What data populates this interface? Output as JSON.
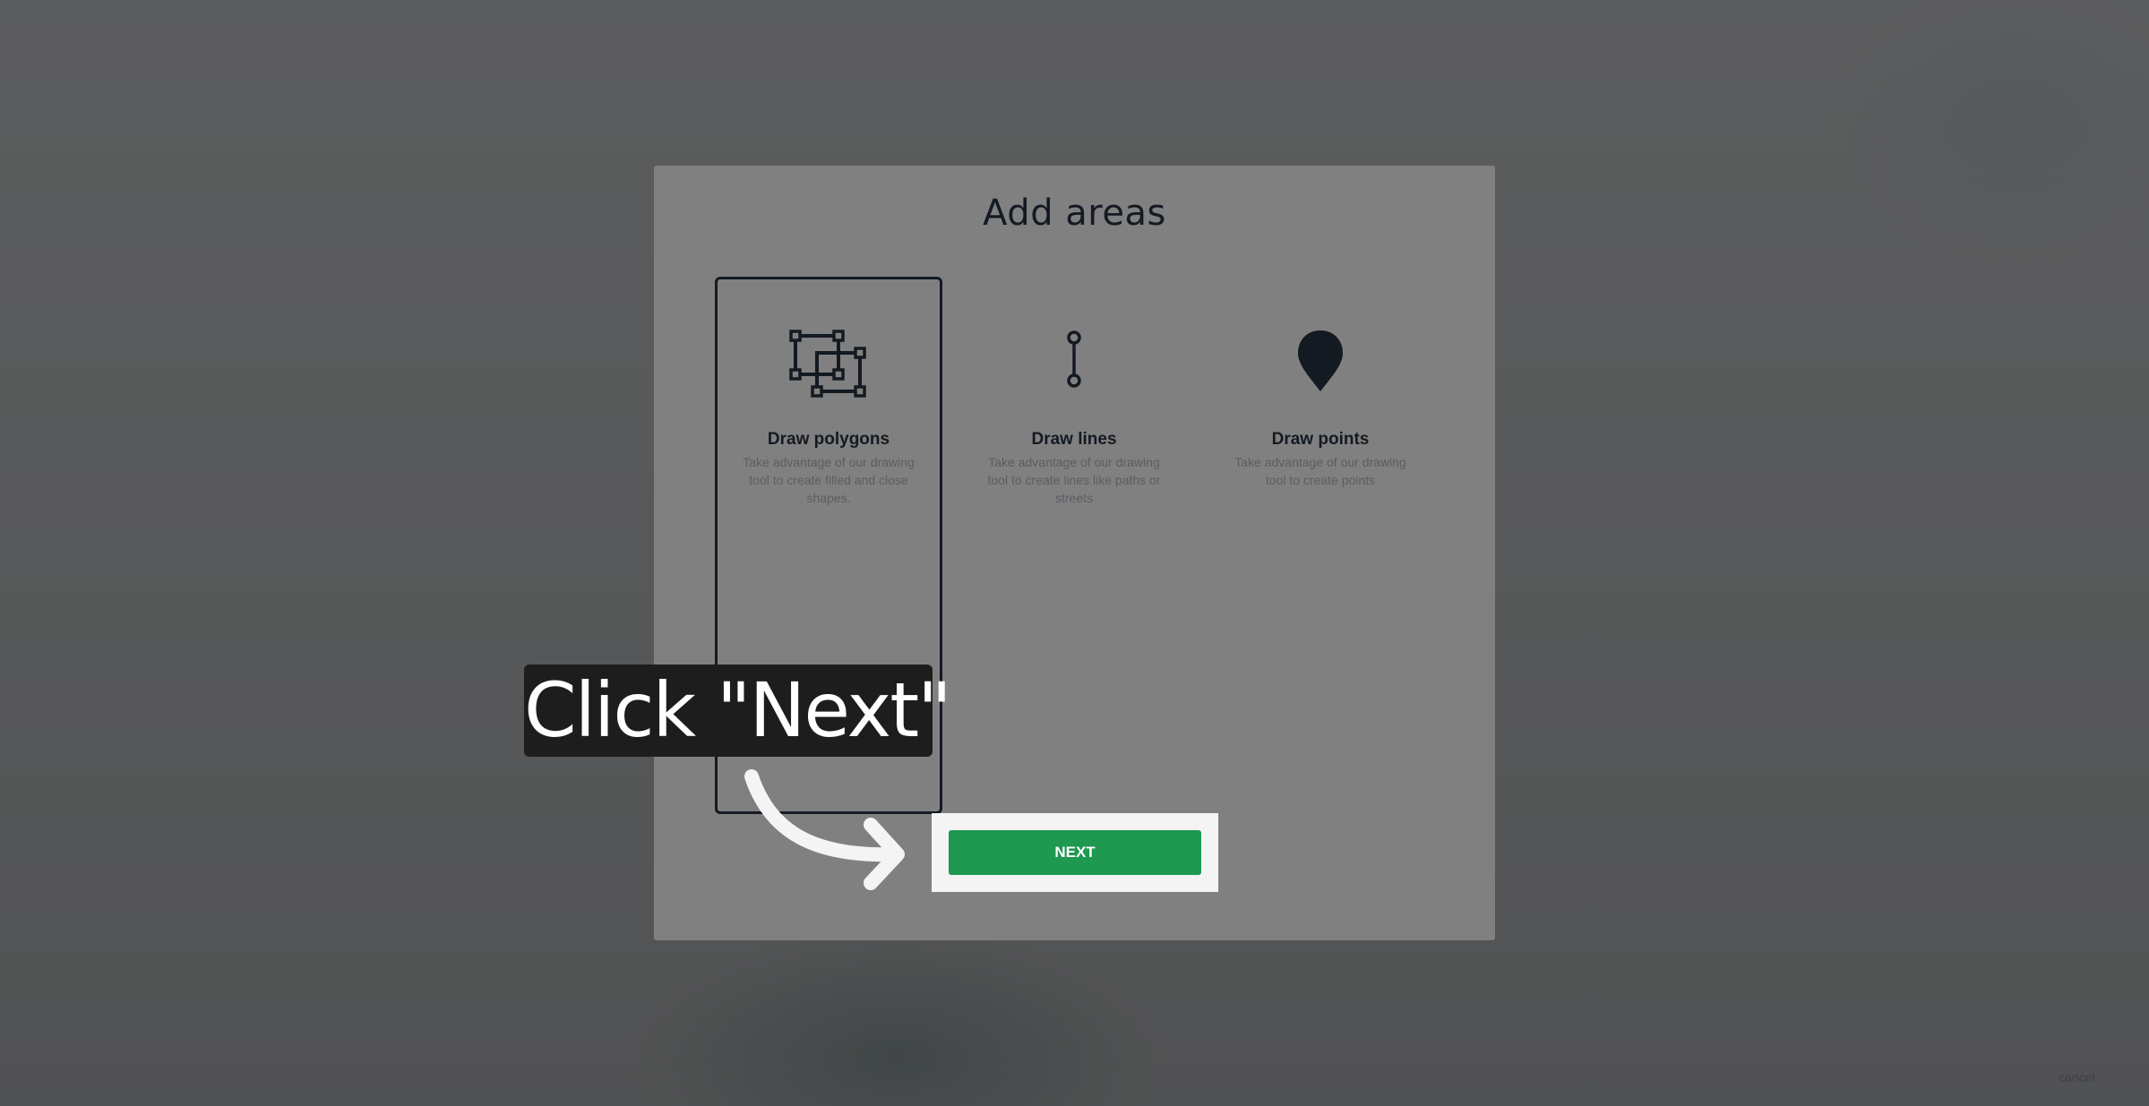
{
  "modal": {
    "title": "Add areas",
    "options": [
      {
        "title": "Draw polygons",
        "description": "Take advantage of our drawing tool to create filled and close shapes.",
        "icon": "polygon-icon",
        "selected": true
      },
      {
        "title": "Draw lines",
        "description": "Take advantage of our drawing tool to create lines like paths or streets",
        "icon": "line-icon",
        "selected": false
      },
      {
        "title": "Draw points",
        "description": "Take advantage of our drawing tool to create points",
        "icon": "map-pin-icon",
        "selected": false
      }
    ],
    "next_label": "NEXT",
    "cancel_label": "cancel"
  },
  "tutorial": {
    "callout_text": "Click \"Next\"",
    "arrow_icon": "curved-arrow-icon"
  },
  "colors": {
    "overlay": "#575859",
    "modal_bg": "#808080",
    "text_dark": "#141a22",
    "primary_green": "#1f9850",
    "callout_bg": "#1d1d1d"
  }
}
